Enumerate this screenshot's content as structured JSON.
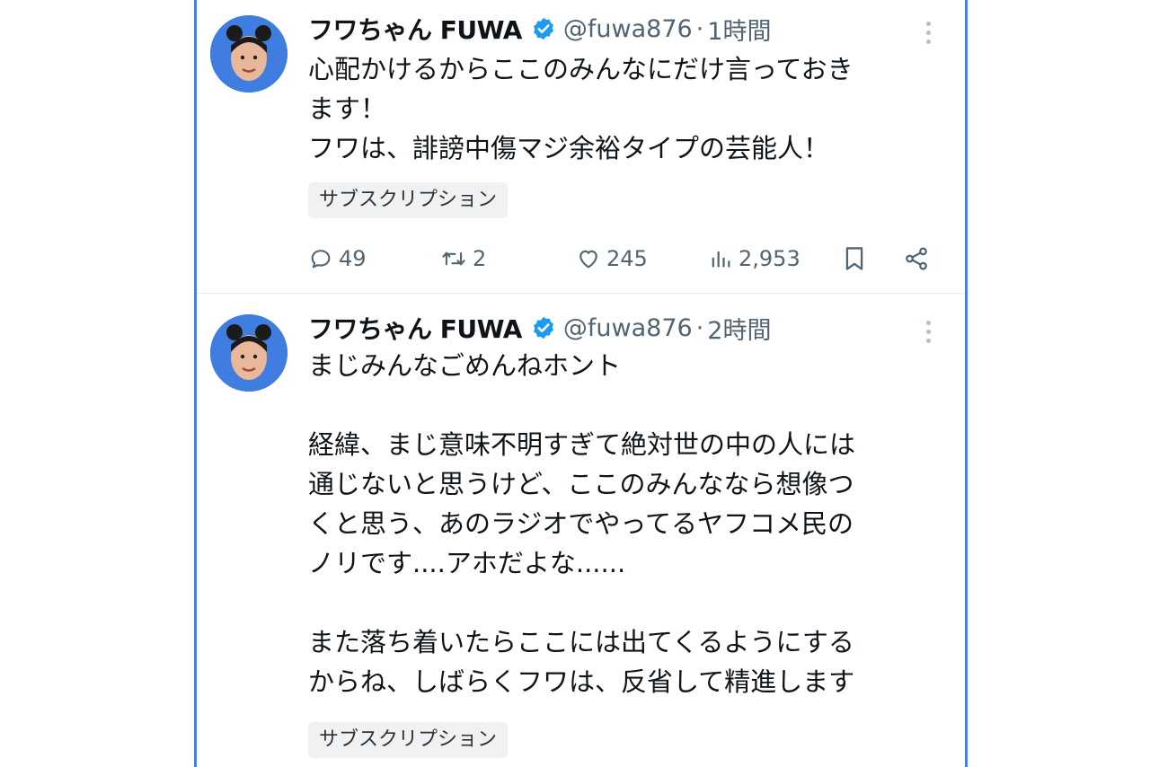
{
  "colors": {
    "accent": "#1d9bf0",
    "frame": "#4a7fe0",
    "secondary_text": "#536471"
  },
  "tweets": [
    {
      "display_name": "フワちゃん FUWA",
      "handle": "@fuwa876",
      "separator": "·",
      "time": "1時間",
      "text": "心配かけるからここのみんなにだけ言っておき\nます！\nフワは、誹謗中傷マジ余裕タイプの芸能人！",
      "badge": "サブスクリプション",
      "stats": {
        "replies": "49",
        "retweets": "2",
        "likes": "245",
        "views": "2,953"
      }
    },
    {
      "display_name": "フワちゃん FUWA",
      "handle": "@fuwa876",
      "separator": "·",
      "time": "2時間",
      "text": "まじみんなごめんねホント\n\n経緯、まじ意味不明すぎて絶対世の中の人には\n通じないと思うけど、ここのみんななら想像つ\nくと思う、あのラジオでやってるヤフコメ民の\nノリです....アホだよな......\n\nまた落ち着いたらここには出てくるようにする\nからね、しばらくフワは、反省して精進します",
      "badge": "サブスクリプション"
    }
  ],
  "icons": {
    "verified": "verified-badge-icon",
    "more": "more-vertical-icon",
    "reply": "reply-icon",
    "retweet": "retweet-icon",
    "like": "heart-icon",
    "views": "views-icon",
    "bookmark": "bookmark-icon",
    "share": "share-icon"
  }
}
